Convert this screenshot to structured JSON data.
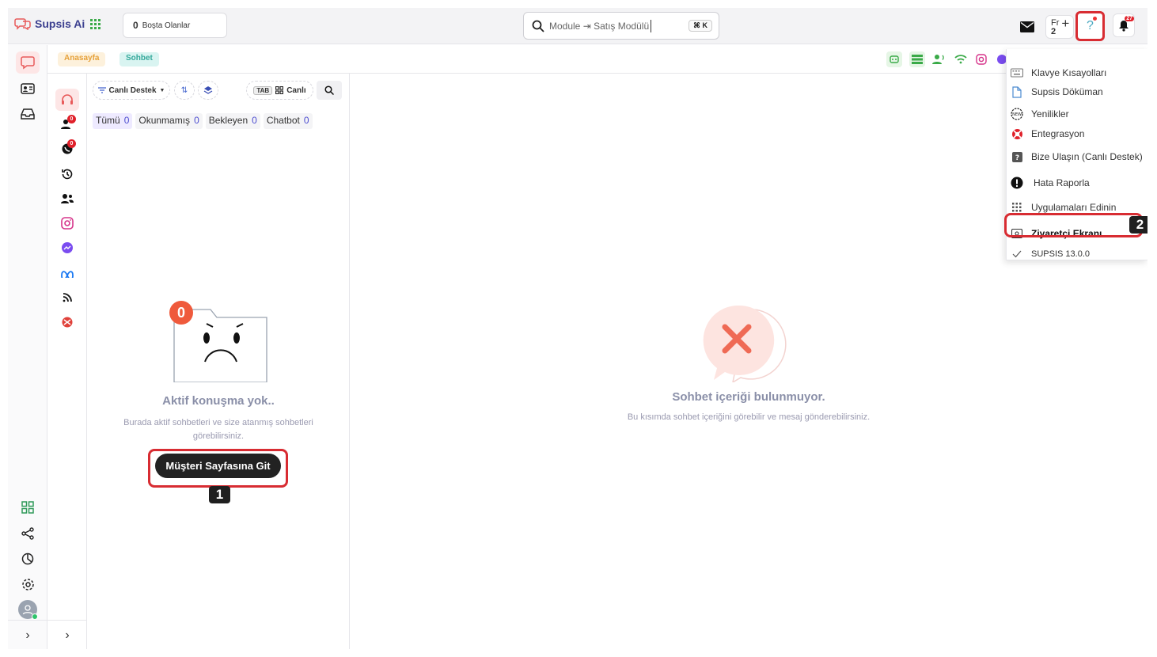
{
  "header": {
    "brand": "Supsis Ai",
    "idle_count": "0",
    "idle_label": "Boşta Olanlar",
    "search_value": "Module ⇥ Satış Modülü",
    "search_shortcut": "⌘ K",
    "fr_label": "Fr",
    "fr_count": "2",
    "plus": "+",
    "help_label": "?",
    "notif_count": "27"
  },
  "breadcrumbs": [
    "Anasayfa",
    "Sohbet"
  ],
  "sidebar2": {
    "assigned_badge": "0",
    "whatsapp_badge": "0"
  },
  "list": {
    "dept_label": "Canlı Destek",
    "tab_key": "TAB",
    "live_label": "Canlı",
    "filters": [
      {
        "label": "Tümü",
        "count": "0"
      },
      {
        "label": "Okunmamış",
        "count": "0"
      },
      {
        "label": "Bekleyen",
        "count": "0"
      },
      {
        "label": "Chatbot",
        "count": "0"
      }
    ],
    "empty_badge": "0",
    "empty_title": "Aktif konuşma yok..",
    "empty_subtitle": "Burada aktif sohbetleri ve size atanmış sohbetleri görebilirsiniz.",
    "goto_button": "Müşteri Sayfasına Git",
    "step1": "1"
  },
  "chat": {
    "empty_title": "Sohbet içeriği bulunmuyor.",
    "empty_subtitle": "Bu kısımda sohbet içeriğini görebilir ve mesaj gönderebilirsiniz."
  },
  "menu": {
    "items": [
      {
        "label": "Klavye Kısayolları",
        "icon": "keyboard-icon"
      },
      {
        "label": "Supsis Döküman",
        "icon": "document-icon"
      },
      {
        "label": "Yenilikler",
        "icon": "new-icon"
      },
      {
        "label": "Entegrasyon",
        "icon": "lifebuoy-icon"
      },
      {
        "label": "Bize Ulaşın (Canlı Destek)",
        "icon": "question-icon"
      },
      {
        "label": "Hata Raporla",
        "icon": "alert-icon"
      },
      {
        "label": "Uygulamaları Edinin",
        "icon": "apps-icon"
      },
      {
        "label": "Ziyaretçi Ekranı",
        "icon": "visitor-screen-icon"
      },
      {
        "label": "SUPSIS 13.0.0",
        "icon": "check-icon"
      }
    ],
    "step2": "2"
  },
  "colors": {
    "accent_red": "#d82c32",
    "brand": "#3b3f8f",
    "filter_count": "#4d4dd0"
  }
}
